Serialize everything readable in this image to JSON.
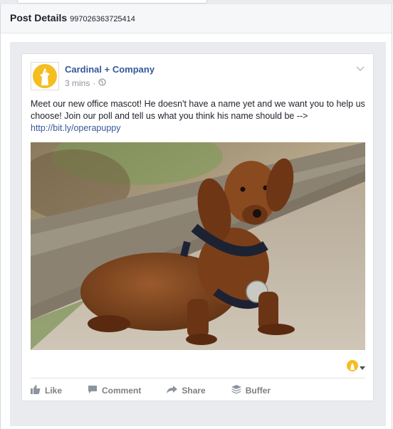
{
  "modal": {
    "title": "Post Details",
    "post_id": "997026363725414"
  },
  "post": {
    "page_name": "Cardinal + Company",
    "time": "3 mins",
    "separator": "·",
    "message": "Meet our new office mascot! He doesn't have a name yet and we want you to help us choose! Join our poll and tell us what you think his name should be -->",
    "link": "http://bit.ly/operapuppy",
    "icons": {
      "audience": "globe-icon",
      "options": "chevron-down-icon",
      "reaction_selector": "page-avatar-icon"
    }
  },
  "actions": [
    {
      "label": "Like",
      "icon": "thumbs-up-icon"
    },
    {
      "label": "Comment",
      "icon": "comment-icon"
    },
    {
      "label": "Share",
      "icon": "share-arrow-icon"
    },
    {
      "label": "Buffer",
      "icon": "buffer-stack-icon"
    }
  ],
  "colors": {
    "link_blue": "#365899",
    "brand_yellow": "#f5bd1f",
    "muted": "#90949c",
    "backdrop": "#e9ebee"
  }
}
